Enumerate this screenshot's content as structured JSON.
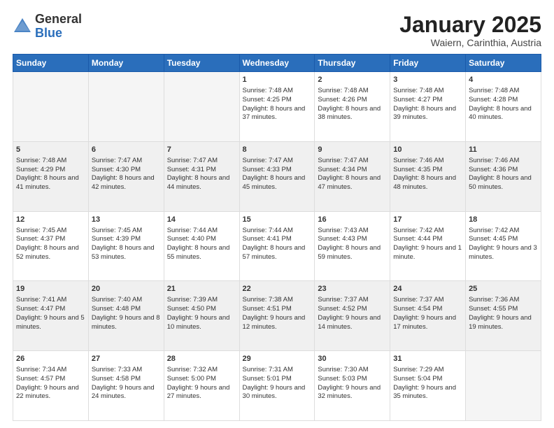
{
  "header": {
    "logo_general": "General",
    "logo_blue": "Blue",
    "main_title": "January 2025",
    "subtitle": "Waiern, Carinthia, Austria"
  },
  "days_of_week": [
    "Sunday",
    "Monday",
    "Tuesday",
    "Wednesday",
    "Thursday",
    "Friday",
    "Saturday"
  ],
  "weeks": [
    {
      "shaded": false,
      "days": [
        {
          "num": "",
          "text": ""
        },
        {
          "num": "",
          "text": ""
        },
        {
          "num": "",
          "text": ""
        },
        {
          "num": "1",
          "text": "Sunrise: 7:48 AM\nSunset: 4:25 PM\nDaylight: 8 hours and 37 minutes."
        },
        {
          "num": "2",
          "text": "Sunrise: 7:48 AM\nSunset: 4:26 PM\nDaylight: 8 hours and 38 minutes."
        },
        {
          "num": "3",
          "text": "Sunrise: 7:48 AM\nSunset: 4:27 PM\nDaylight: 8 hours and 39 minutes."
        },
        {
          "num": "4",
          "text": "Sunrise: 7:48 AM\nSunset: 4:28 PM\nDaylight: 8 hours and 40 minutes."
        }
      ]
    },
    {
      "shaded": true,
      "days": [
        {
          "num": "5",
          "text": "Sunrise: 7:48 AM\nSunset: 4:29 PM\nDaylight: 8 hours and 41 minutes."
        },
        {
          "num": "6",
          "text": "Sunrise: 7:47 AM\nSunset: 4:30 PM\nDaylight: 8 hours and 42 minutes."
        },
        {
          "num": "7",
          "text": "Sunrise: 7:47 AM\nSunset: 4:31 PM\nDaylight: 8 hours and 44 minutes."
        },
        {
          "num": "8",
          "text": "Sunrise: 7:47 AM\nSunset: 4:33 PM\nDaylight: 8 hours and 45 minutes."
        },
        {
          "num": "9",
          "text": "Sunrise: 7:47 AM\nSunset: 4:34 PM\nDaylight: 8 hours and 47 minutes."
        },
        {
          "num": "10",
          "text": "Sunrise: 7:46 AM\nSunset: 4:35 PM\nDaylight: 8 hours and 48 minutes."
        },
        {
          "num": "11",
          "text": "Sunrise: 7:46 AM\nSunset: 4:36 PM\nDaylight: 8 hours and 50 minutes."
        }
      ]
    },
    {
      "shaded": false,
      "days": [
        {
          "num": "12",
          "text": "Sunrise: 7:45 AM\nSunset: 4:37 PM\nDaylight: 8 hours and 52 minutes."
        },
        {
          "num": "13",
          "text": "Sunrise: 7:45 AM\nSunset: 4:39 PM\nDaylight: 8 hours and 53 minutes."
        },
        {
          "num": "14",
          "text": "Sunrise: 7:44 AM\nSunset: 4:40 PM\nDaylight: 8 hours and 55 minutes."
        },
        {
          "num": "15",
          "text": "Sunrise: 7:44 AM\nSunset: 4:41 PM\nDaylight: 8 hours and 57 minutes."
        },
        {
          "num": "16",
          "text": "Sunrise: 7:43 AM\nSunset: 4:43 PM\nDaylight: 8 hours and 59 minutes."
        },
        {
          "num": "17",
          "text": "Sunrise: 7:42 AM\nSunset: 4:44 PM\nDaylight: 9 hours and 1 minute."
        },
        {
          "num": "18",
          "text": "Sunrise: 7:42 AM\nSunset: 4:45 PM\nDaylight: 9 hours and 3 minutes."
        }
      ]
    },
    {
      "shaded": true,
      "days": [
        {
          "num": "19",
          "text": "Sunrise: 7:41 AM\nSunset: 4:47 PM\nDaylight: 9 hours and 5 minutes."
        },
        {
          "num": "20",
          "text": "Sunrise: 7:40 AM\nSunset: 4:48 PM\nDaylight: 9 hours and 8 minutes."
        },
        {
          "num": "21",
          "text": "Sunrise: 7:39 AM\nSunset: 4:50 PM\nDaylight: 9 hours and 10 minutes."
        },
        {
          "num": "22",
          "text": "Sunrise: 7:38 AM\nSunset: 4:51 PM\nDaylight: 9 hours and 12 minutes."
        },
        {
          "num": "23",
          "text": "Sunrise: 7:37 AM\nSunset: 4:52 PM\nDaylight: 9 hours and 14 minutes."
        },
        {
          "num": "24",
          "text": "Sunrise: 7:37 AM\nSunset: 4:54 PM\nDaylight: 9 hours and 17 minutes."
        },
        {
          "num": "25",
          "text": "Sunrise: 7:36 AM\nSunset: 4:55 PM\nDaylight: 9 hours and 19 minutes."
        }
      ]
    },
    {
      "shaded": false,
      "days": [
        {
          "num": "26",
          "text": "Sunrise: 7:34 AM\nSunset: 4:57 PM\nDaylight: 9 hours and 22 minutes."
        },
        {
          "num": "27",
          "text": "Sunrise: 7:33 AM\nSunset: 4:58 PM\nDaylight: 9 hours and 24 minutes."
        },
        {
          "num": "28",
          "text": "Sunrise: 7:32 AM\nSunset: 5:00 PM\nDaylight: 9 hours and 27 minutes."
        },
        {
          "num": "29",
          "text": "Sunrise: 7:31 AM\nSunset: 5:01 PM\nDaylight: 9 hours and 30 minutes."
        },
        {
          "num": "30",
          "text": "Sunrise: 7:30 AM\nSunset: 5:03 PM\nDaylight: 9 hours and 32 minutes."
        },
        {
          "num": "31",
          "text": "Sunrise: 7:29 AM\nSunset: 5:04 PM\nDaylight: 9 hours and 35 minutes."
        },
        {
          "num": "",
          "text": ""
        }
      ]
    }
  ]
}
